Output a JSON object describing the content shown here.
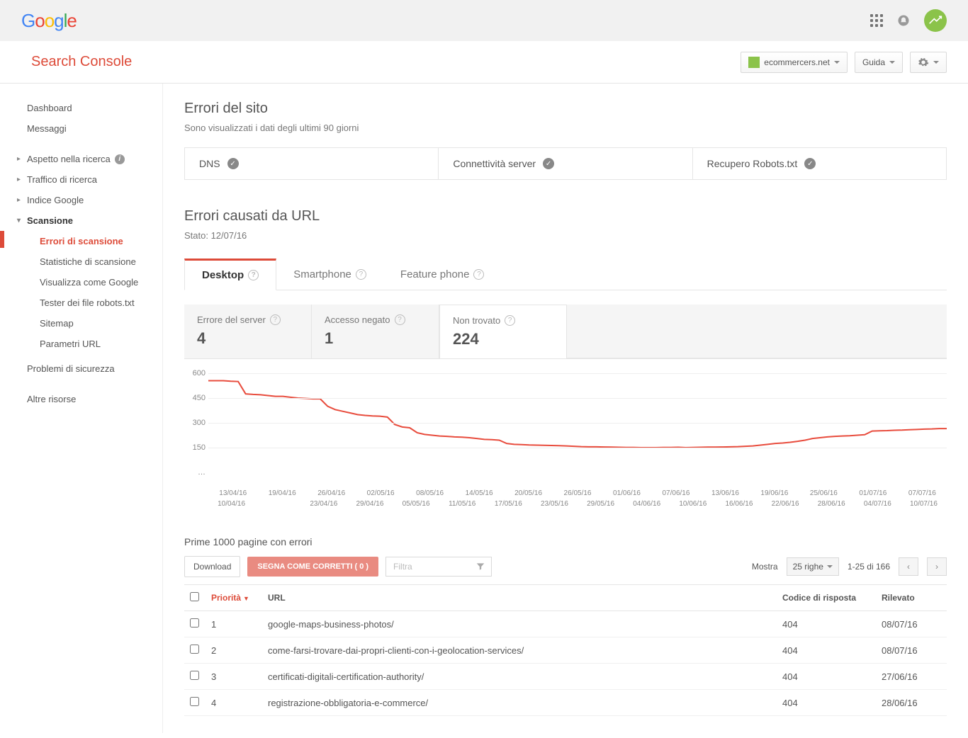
{
  "header": {
    "product": "Search Console",
    "site": "ecommercers.net",
    "help_label": "Guida"
  },
  "sidebar": {
    "dashboard": "Dashboard",
    "messages": "Messaggi",
    "search_appearance": "Aspetto nella ricerca",
    "search_traffic": "Traffico di ricerca",
    "google_index": "Indice Google",
    "crawl": "Scansione",
    "crawl_errors": "Errori di scansione",
    "crawl_stats": "Statistiche di scansione",
    "fetch_google": "Visualizza come Google",
    "robots_tester": "Tester dei file robots.txt",
    "sitemap": "Sitemap",
    "url_params": "Parametri URL",
    "security": "Problemi di sicurezza",
    "other": "Altre risorse"
  },
  "site_errors": {
    "title": "Errori del sito",
    "subtitle": "Sono visualizzati i dati degli ultimi 90 giorni",
    "cards": {
      "dns": "DNS",
      "conn": "Connettività server",
      "robots": "Recupero Robots.txt"
    }
  },
  "url_errors": {
    "title": "Errori causati da URL",
    "state": "Stato: 12/07/16",
    "tabs": {
      "desktop": "Desktop",
      "smartphone": "Smartphone",
      "feature": "Feature phone"
    },
    "stats": {
      "server": {
        "label": "Errore del server",
        "value": "4"
      },
      "denied": {
        "label": "Accesso negato",
        "value": "1"
      },
      "notfound": {
        "label": "Non trovato",
        "value": "224"
      }
    }
  },
  "chart_data": {
    "type": "line",
    "title": "",
    "xlabel": "",
    "ylabel": "",
    "ylim": [
      0,
      600
    ],
    "y_ticks": [
      600,
      450,
      300,
      150
    ],
    "x_top": [
      "13/04/16",
      "19/04/16",
      "26/04/16",
      "02/05/16",
      "08/05/16",
      "14/05/16",
      "20/05/16",
      "26/05/16",
      "01/06/16",
      "07/06/16",
      "13/06/16",
      "19/06/16",
      "25/06/16",
      "01/07/16",
      "07/07/16"
    ],
    "x_bottom": [
      "10/04/16",
      "",
      "23/04/16",
      "29/04/16",
      "05/05/16",
      "11/05/16",
      "17/05/16",
      "23/05/16",
      "29/05/16",
      "04/06/16",
      "10/06/16",
      "16/06/16",
      "22/06/16",
      "28/06/16",
      "04/07/16",
      "10/07/16"
    ],
    "series": [
      {
        "name": "Non trovato",
        "values": [
          555,
          555,
          555,
          552,
          550,
          475,
          472,
          470,
          465,
          460,
          460,
          455,
          450,
          448,
          445,
          445,
          400,
          380,
          370,
          360,
          350,
          345,
          342,
          340,
          335,
          290,
          275,
          270,
          240,
          230,
          225,
          220,
          218,
          215,
          213,
          210,
          205,
          200,
          198,
          195,
          175,
          170,
          168,
          166,
          165,
          164,
          163,
          162,
          160,
          158,
          156,
          155,
          155,
          154,
          153,
          152,
          151,
          151,
          150,
          150,
          150,
          151,
          151,
          152,
          150,
          151,
          152,
          153,
          153,
          154,
          155,
          156,
          158,
          160,
          165,
          170,
          175,
          178,
          182,
          188,
          195,
          205,
          210,
          215,
          218,
          220,
          222,
          225,
          228,
          250,
          252,
          253,
          255,
          256,
          258,
          260,
          262,
          263,
          265,
          265
        ]
      }
    ]
  },
  "table": {
    "title": "Prime 1000 pagine con errori",
    "download": "Download",
    "mark_fixed": "SEGNA COME CORRETTI ( 0 )",
    "filter_placeholder": "Filtra",
    "show_label": "Mostra",
    "rows_label": "25 righe",
    "page_info": "1-25 di 166",
    "cols": {
      "priority": "Priorità",
      "url": "URL",
      "code": "Codice di risposta",
      "detected": "Rilevato"
    },
    "rows": [
      {
        "priority": "1",
        "url": "google-maps-business-photos/",
        "code": "404",
        "detected": "08/07/16"
      },
      {
        "priority": "2",
        "url": "come-farsi-trovare-dai-propri-clienti-con-i-geolocation-services/",
        "code": "404",
        "detected": "08/07/16"
      },
      {
        "priority": "3",
        "url": "certificati-digitali-certification-authority/",
        "code": "404",
        "detected": "27/06/16"
      },
      {
        "priority": "4",
        "url": "registrazione-obbligatoria-e-commerce/",
        "code": "404",
        "detected": "28/06/16"
      }
    ]
  }
}
